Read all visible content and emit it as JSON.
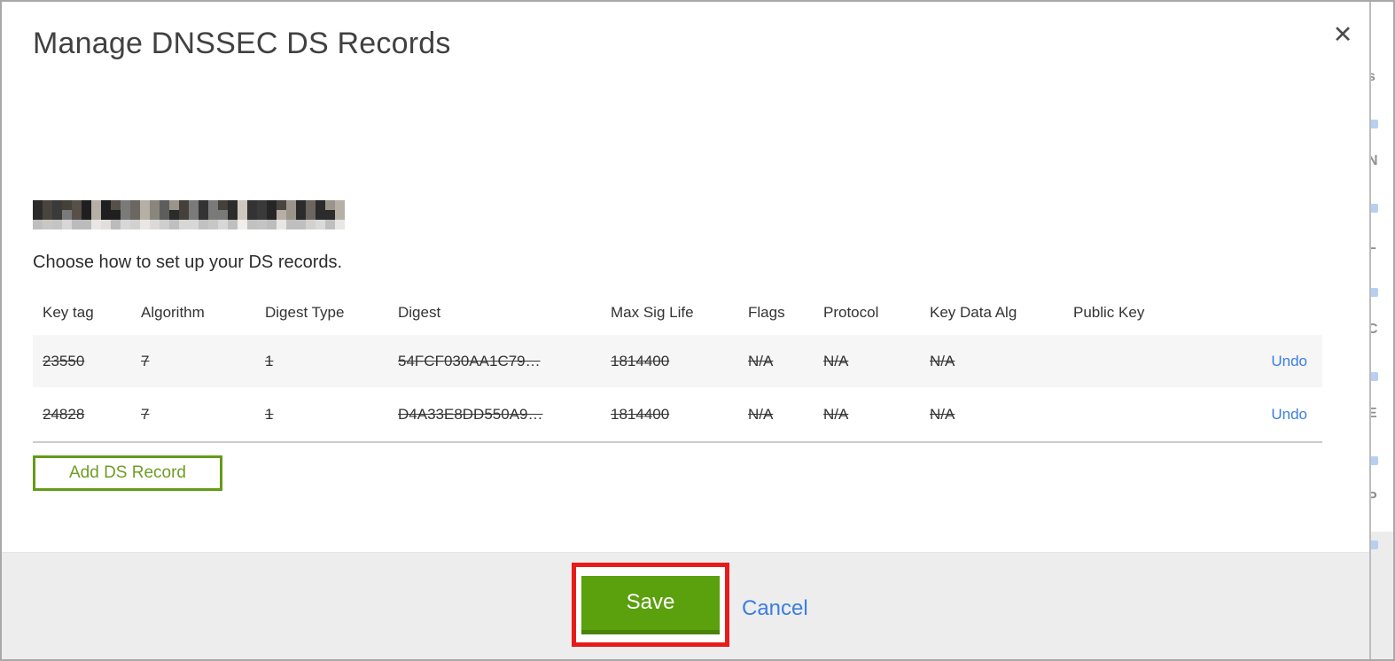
{
  "modal": {
    "title": "Manage DNSSEC DS Records",
    "close_icon": "✕",
    "domain_redacted": true,
    "subtitle": "Choose how to set up your DS records.",
    "table": {
      "headers": [
        "Key tag",
        "Algorithm",
        "Digest Type",
        "Digest",
        "Max Sig Life",
        "Flags",
        "Protocol",
        "Key Data Alg",
        "Public Key",
        ""
      ],
      "rows": [
        {
          "cells": [
            "23550",
            "7",
            "1",
            "54FCF030AA1C79…",
            "1814400",
            "N/A",
            "N/A",
            "N/A",
            ""
          ],
          "action": "Undo",
          "struck": true
        },
        {
          "cells": [
            "24828",
            "7",
            "1",
            "D4A33E8DD550A9…",
            "1814400",
            "N/A",
            "N/A",
            "N/A",
            ""
          ],
          "action": "Undo",
          "struck": true
        }
      ]
    },
    "add_ds_record_label": "Add DS Record",
    "footer": {
      "save_label": "Save",
      "cancel_label": "Cancel"
    }
  },
  "annotation": {
    "shape": "red-rectangle-highlight",
    "target": "save-button",
    "color": "#e81b1b"
  },
  "background_page": {
    "edge_letter_fragments": [
      "s",
      "N",
      "L",
      "C",
      "E",
      "P"
    ]
  },
  "colors": {
    "save_green": "#5ba00d",
    "save_green_dark": "#4a830a",
    "add_green": "#649b17",
    "link_blue": "#3c7de2",
    "footer_gray": "#ededed",
    "row_gray": "#f6f6f6",
    "annotation_red": "#e81b1b"
  }
}
